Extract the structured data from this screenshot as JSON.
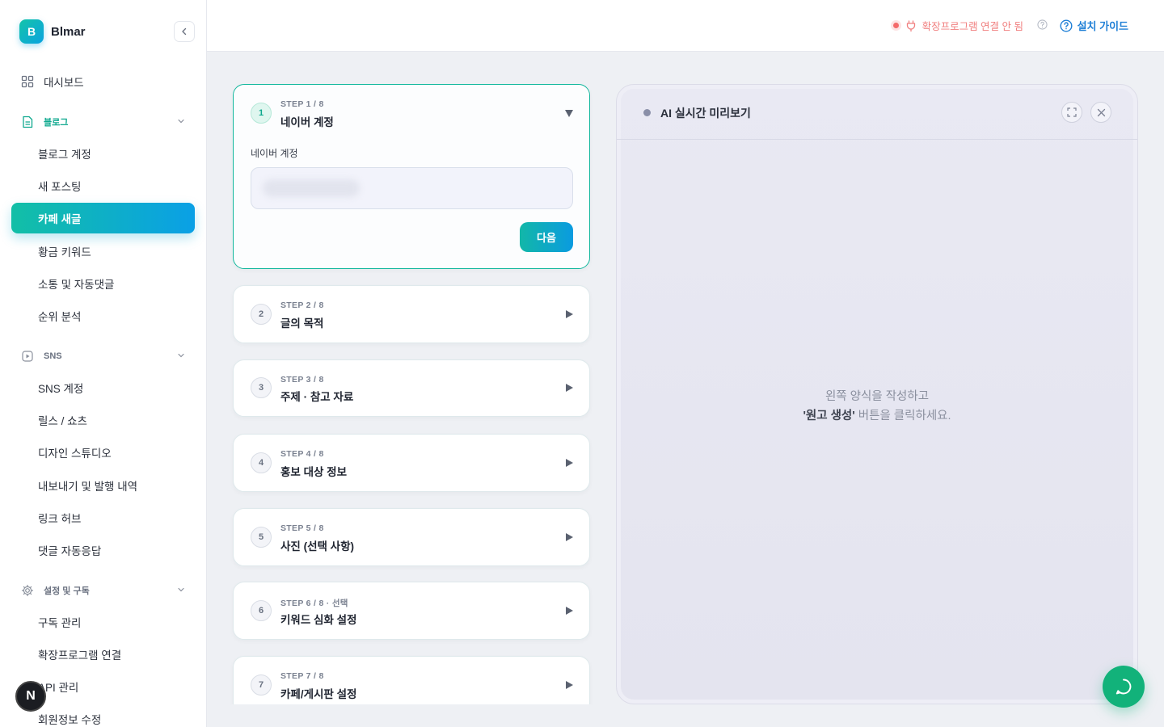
{
  "brand": {
    "logo_letter": "B",
    "name": "Blmar"
  },
  "sidebar": {
    "dashboard": "대시보드",
    "sections": [
      {
        "label": "블로그",
        "items": [
          "블로그 계정",
          "새 포스팅",
          "카페 새글",
          "황금 키워드",
          "소통 및 자동댓글",
          "순위 분석"
        ]
      },
      {
        "label": "SNS",
        "items": [
          "SNS 계정",
          "릴스 / 쇼츠",
          "디자인 스튜디오",
          "내보내기 및 발행 내역",
          "링크 허브",
          "댓글 자동응답"
        ]
      },
      {
        "label": "설정 및 구독",
        "items": [
          "구독 관리",
          "확장프로그램 연결",
          "API 관리",
          "회원정보 수정"
        ]
      }
    ],
    "active_item": "카페 새글",
    "avatar_letter": "N"
  },
  "topbar": {
    "extension_status": "확장프로그램 연결 안 됨",
    "guide_label": "설치 가이드"
  },
  "steps": [
    {
      "num": "1",
      "meta": "STEP 1 / 8",
      "title": "네이버 계정",
      "open": true,
      "field_label": "네이버 계정",
      "next_label": "다음"
    },
    {
      "num": "2",
      "meta": "STEP 2 / 8",
      "title": "글의 목적"
    },
    {
      "num": "3",
      "meta": "STEP 3 / 8",
      "title": "주제 · 참고 자료"
    },
    {
      "num": "4",
      "meta": "STEP 4 / 8",
      "title": "홍보 대상 정보"
    },
    {
      "num": "5",
      "meta": "STEP 5 / 8",
      "title": "사진 (선택 사항)"
    },
    {
      "num": "6",
      "meta": "STEP 6 / 8 · 선택",
      "title": "키워드 심화 설정"
    },
    {
      "num": "7",
      "meta": "STEP 7 / 8",
      "title": "카페/게시판 설정"
    }
  ],
  "preview": {
    "title": "AI 실시간 미리보기",
    "message_line1": "왼쪽 양식을 작성하고",
    "message_bold": "'원고 생성'",
    "message_rest": " 버튼을 클릭하세요."
  },
  "colors": {
    "accent_teal": "#14b89e",
    "accent_blue": "#0aa0e6",
    "status_red": "#f07f7f",
    "link_blue": "#1f7fd6",
    "chat_green": "#12b27a"
  }
}
